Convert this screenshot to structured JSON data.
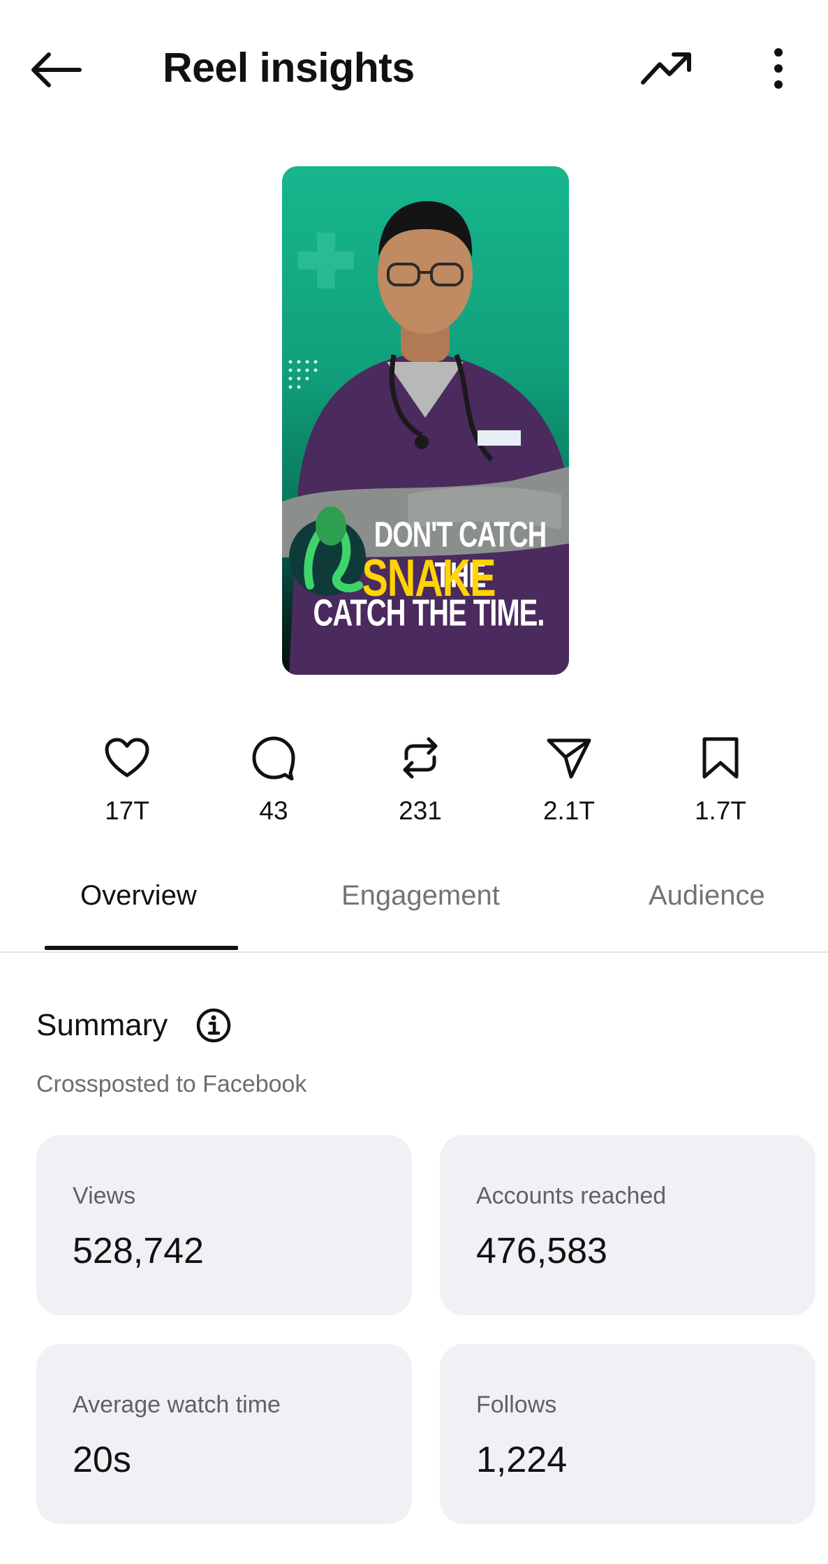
{
  "header": {
    "title": "Reel insights",
    "back_icon": "arrow-left-icon",
    "trend_icon": "trending-up-icon",
    "more_icon": "more-vertical-icon"
  },
  "thumbnail": {
    "caption_line1": "DON'T CATCH THE",
    "caption_line2": "SNAKE",
    "caption_line3": "CATCH THE TIME.",
    "accent_color": "#17b68d",
    "highlight_color": "#ffd400"
  },
  "stats": [
    {
      "icon": "heart-icon",
      "count": "17T"
    },
    {
      "icon": "comment-icon",
      "count": "43"
    },
    {
      "icon": "repost-icon",
      "count": "231"
    },
    {
      "icon": "send-icon",
      "count": "2.1T"
    },
    {
      "icon": "bookmark-icon",
      "count": "1.7T"
    }
  ],
  "tabs": [
    {
      "label": "Overview",
      "active": true
    },
    {
      "label": "Engagement",
      "active": false
    },
    {
      "label": "Audience",
      "active": false
    }
  ],
  "summary": {
    "title": "Summary",
    "info_icon": "info-icon",
    "subtitle": "Crossposted to Facebook"
  },
  "cards": [
    {
      "label": "Views",
      "value": "528,742"
    },
    {
      "label": "Accounts reached",
      "value": "476,583"
    },
    {
      "label": "Average watch time",
      "value": "20s"
    },
    {
      "label": "Follows",
      "value": "1,224"
    }
  ]
}
